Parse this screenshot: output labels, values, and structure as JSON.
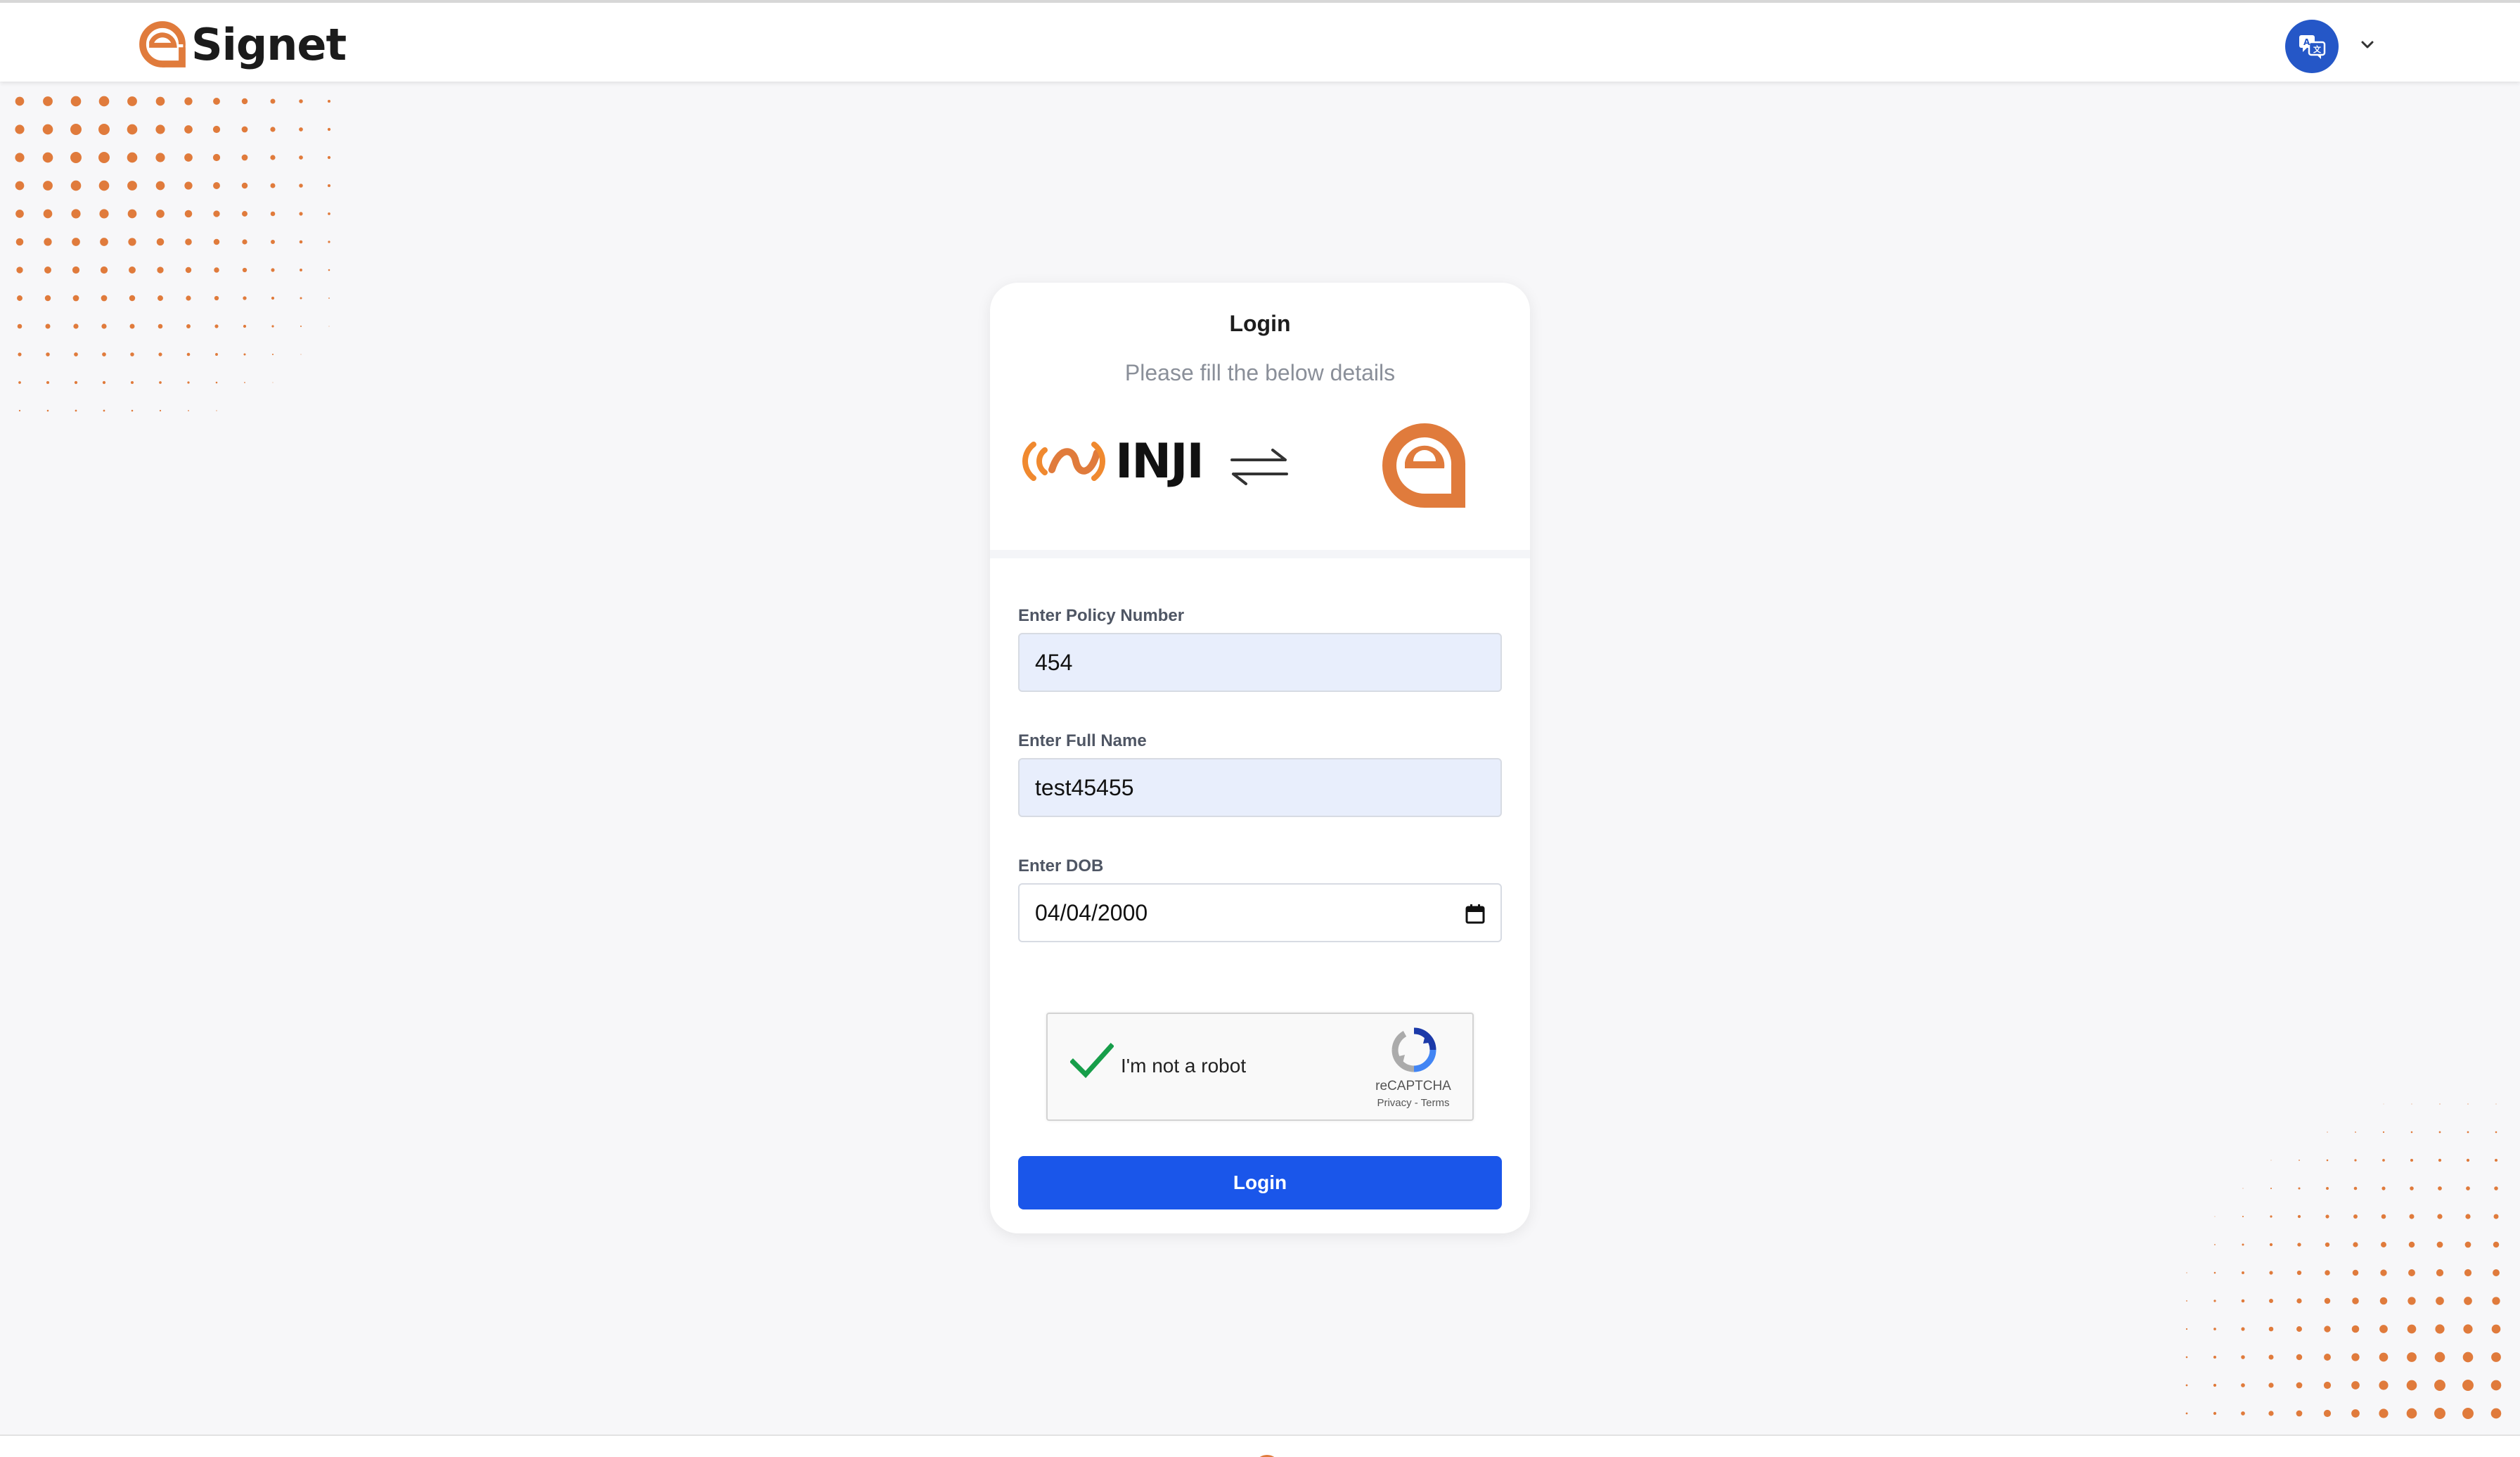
{
  "header": {
    "brand_name": "Signet",
    "language_icon": "translate-icon",
    "caret_icon": "chevron-down-icon"
  },
  "card": {
    "title": "Login",
    "subtitle": "Please fill the below details",
    "inji_wordmark": "INJI",
    "swap_icon": "swap-arrows-icon"
  },
  "form": {
    "policy_label": "Enter Policy Number",
    "policy_value": "454",
    "name_label": "Enter Full Name",
    "name_value": "test45455",
    "dob_label": "Enter DOB",
    "dob_value": "04/04/2000",
    "calendar_icon": "calendar-icon"
  },
  "captcha": {
    "label": "I'm not a robot",
    "checked": true,
    "brand": "reCAPTCHA",
    "links": "Privacy - Terms"
  },
  "login_button": "Login",
  "colors": {
    "brand_orange": "#e07b3c",
    "primary_blue": "#1a56ea",
    "language_blue": "#2557c7",
    "filled_input": "#e8eefc",
    "page_bg": "#f7f7f9"
  }
}
